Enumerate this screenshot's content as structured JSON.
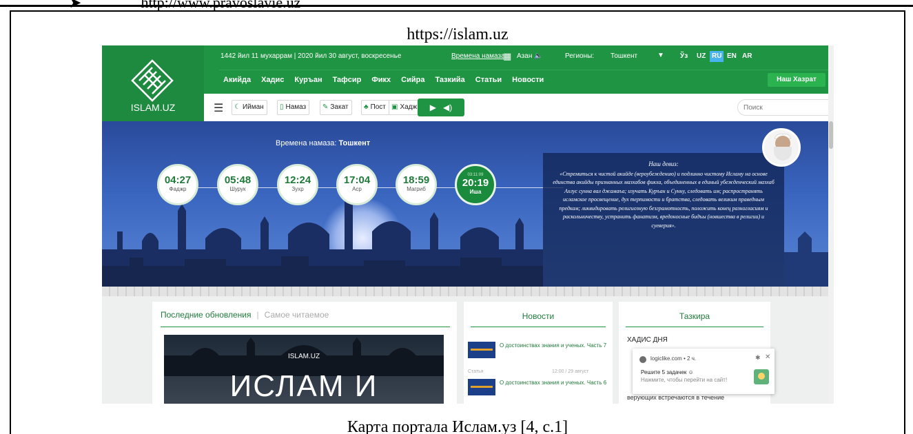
{
  "doc": {
    "bullet_arrow": "➤",
    "bullet_url": "http://www.pravoslavie.uz",
    "frame_title": "https://islam.uz",
    "caption": "Карта портала Ислам.уз [4, с.1]"
  },
  "site": {
    "logo_text": "ISLAM.UZ",
    "date_line": "1442 йил 11 мухаррам | 2020 йил 30 август, воскресенье",
    "prayer_times_link": "Времена намаза",
    "azan_label": "Азан",
    "regions_label": "Регионы:",
    "region_value": "Тошкент",
    "languages": [
      "Ўз",
      "UZ",
      "RU",
      "EN",
      "AR"
    ],
    "active_language": "RU",
    "nav": [
      "Акийда",
      "Хадис",
      "Куръан",
      "Тафсир",
      "Фикх",
      "Сийра",
      "Тазкийа",
      "Статьи",
      "Новости"
    ],
    "our_hazrat_button": "Наш Хазрат",
    "toolbar": [
      "Иймaн",
      "Намаз",
      "Закат",
      "Пост",
      "Хадж"
    ],
    "search_placeholder": "Поиск",
    "accent_color": "#1f9443"
  },
  "hero": {
    "title_prefix": "Времена намаза:",
    "title_city": "Тошкент",
    "prayers": [
      {
        "time": "04:27",
        "name": "Фаджр"
      },
      {
        "time": "05:48",
        "name": "Шурук"
      },
      {
        "time": "12:24",
        "name": "Зухр"
      },
      {
        "time": "17:04",
        "name": "Аср"
      },
      {
        "time": "18:59",
        "name": "Магриб"
      }
    ],
    "current": {
      "countdown": "03:11:09",
      "time": "20:19",
      "name": "Иша"
    },
    "motto_head": "Наш девиз:",
    "motto_text": "«Стремиться к чистой акийде (вероубеждению) и подлинно чистому Исламу на основе единства акийды признанных мазхабов фикха, объединенных в единый убежденческий мазхаб Ахлус сунна вал джамаъа; изучать Куръан и Сунну, следовать им; распространять исламское просвещение, дух терпимости и братства, следовать великим праведным предкам; ликвидировать религиозную безграмотность, положить конец разногласиям и раскольничеству, устранить фанатизм, вредоносные бидъы (новшества в религии) и суеверия»."
  },
  "content": {
    "tab_latest": "Последние обновления",
    "tab_sep": "|",
    "tab_popular": "Самое читаемое",
    "banner_small": "ISLAM.UZ",
    "banner_big": "ИСЛАМ И",
    "news_head": "Новости",
    "news": [
      {
        "title": "О достоинствах знания и ученых. Часть 7"
      },
      {
        "title": "О достоинствах знания и ученых. Часть 6"
      }
    ],
    "news_kind": "Статья",
    "news_time": "12:00 / 29 август",
    "tazkira_head": "Тазкира",
    "hadith_head": "ХАДИС ДНЯ",
    "hadith_text": "верующих встречаются в течение"
  },
  "notification": {
    "site": "logiclike.com • 2 ч.",
    "line1": "Решите 5 задачек ☺",
    "line2": "Нажмите, чтобы перейти на сайт!"
  }
}
